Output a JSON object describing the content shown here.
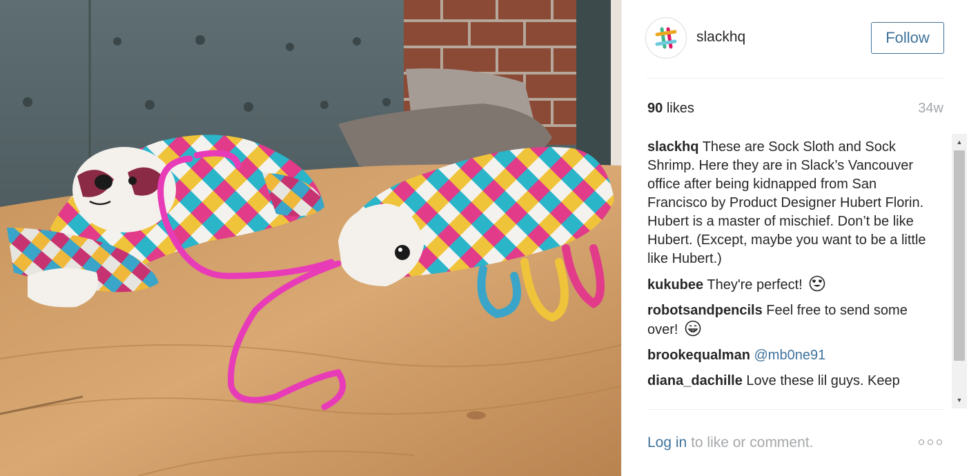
{
  "post": {
    "author": "slackhq",
    "follow_label": "Follow",
    "likes_count": "90",
    "likes_word": "likes",
    "age": "34w"
  },
  "comments": [
    {
      "user": "slackhq",
      "text": "These are Sock Sloth and Sock Shrimp. Here they are in Slack’s Vancouver office after being kidnapped from San Francisco by Product Designer Hubert Florin. Hubert is a master of mischief. Don’t be like Hubert. (Except, maybe you want to be a little like Hubert.)"
    },
    {
      "user": "kukubee",
      "text": "They're perfect!",
      "emoji": "heart-eyes-emoji"
    },
    {
      "user": "robotsandpencils",
      "text": "Feel free to send some over!",
      "emoji": "grinning-emoji"
    },
    {
      "user": "brookequalman",
      "mention": "@mb0ne91"
    },
    {
      "user": "diana_dachille",
      "text": "Love these lil guys. Keep"
    }
  ],
  "footer": {
    "login_label": "Log in",
    "login_suffix": "to like or comment."
  },
  "icons": {
    "avatar": "slack-logo-icon",
    "more": "more-options-icon",
    "scroll_up": "scroll-up-arrow-icon",
    "scroll_down": "scroll-down-arrow-icon"
  },
  "colors": {
    "link": "#3f729b",
    "muted": "#a5a7aa",
    "text": "#262626",
    "pipe_cleaner": "#e83bb8"
  }
}
